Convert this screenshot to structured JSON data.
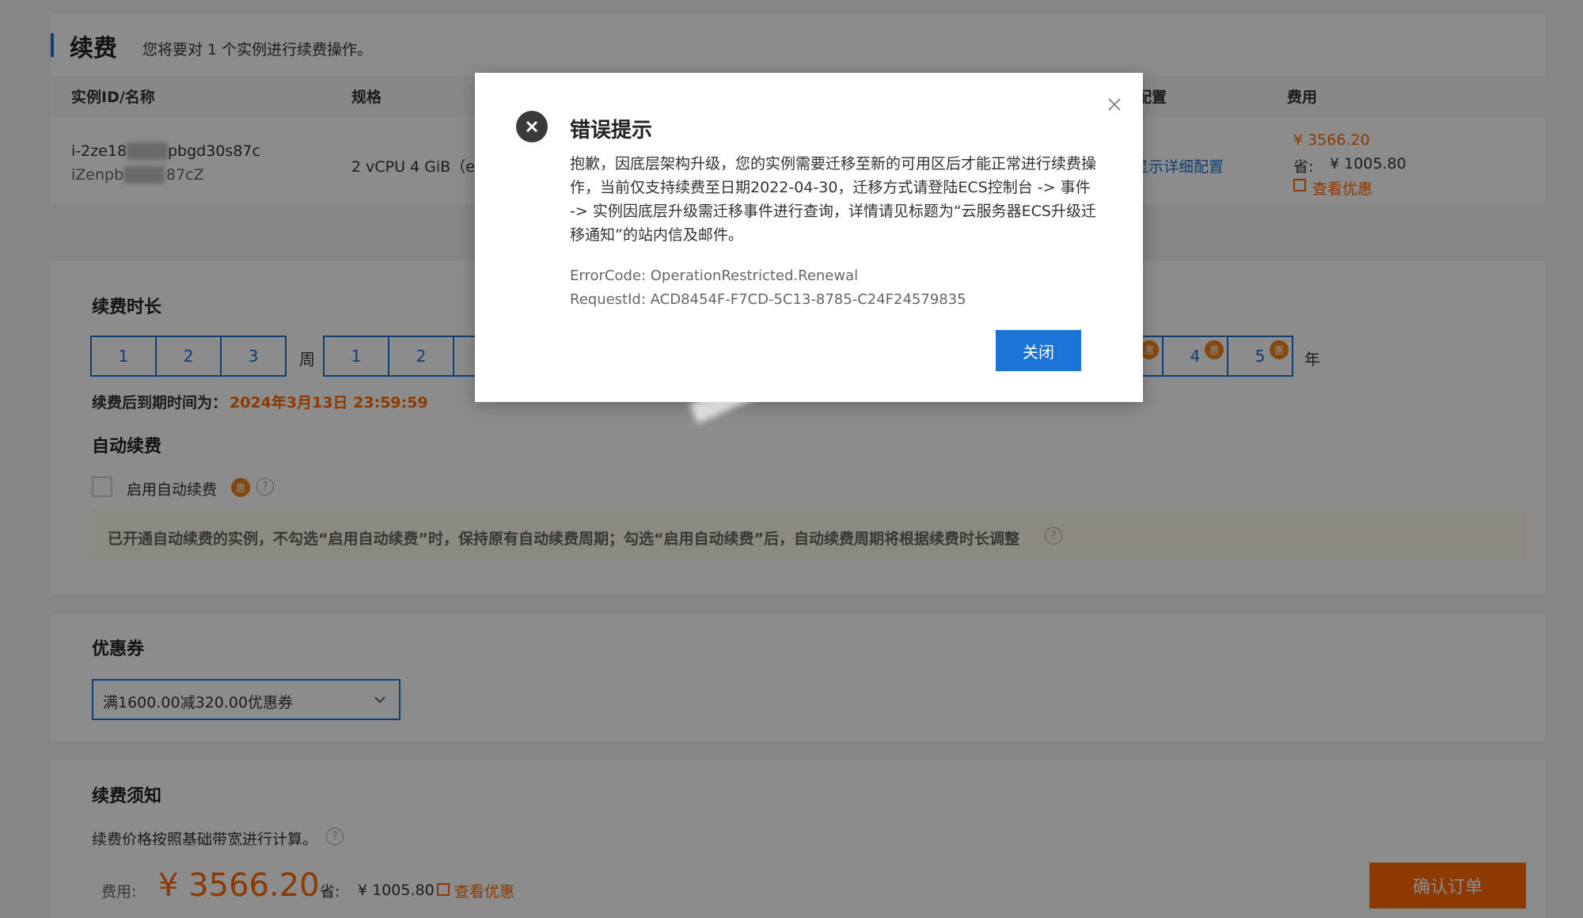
{
  "header": {
    "title": "续费",
    "subtitle": "您将要对 1 个实例进行续费操作。"
  },
  "instance_table": {
    "columns": [
      "实例ID/名称",
      "规格",
      "配置",
      "费用"
    ],
    "row": {
      "id_start": "i-2ze18",
      "id_end": "pbgd30s87c",
      "name_start": "iZenpb",
      "name_end": "87cZ",
      "spec": "2 vCPU 4 GiB（e",
      "config_link": "显示详细配置",
      "price": "¥ 3566.20",
      "save_label": "省:",
      "save_amount": "¥ 1005.80",
      "view_discount": "查看优惠"
    }
  },
  "duration": {
    "title": "续费时长",
    "week_options": [
      "1",
      "2",
      "3"
    ],
    "week_unit": "周",
    "month_options": [
      "1",
      "2"
    ],
    "year_options": [
      "4",
      "5"
    ],
    "year_unit": "年",
    "discount_badge": "惠",
    "expiry_label": "续费后到期时间为：",
    "expiry_value": "2024年3月13日 23:59:59"
  },
  "auto_renew": {
    "title": "自动续费",
    "checkbox_label": "启用自动续费",
    "checked": false,
    "badge": "惠",
    "notice": "已开通自动续费的实例，不勾选“启用自动续费”时，保持原有自动续费周期；勾选“启用自动续费”后，自动续费周期将根据续费时长调整"
  },
  "coupon": {
    "title": "优惠券",
    "selected": "满1600.00减320.00优惠券"
  },
  "terms": {
    "title": "续费须知",
    "text": "续费价格按照基础带宽进行计算。"
  },
  "footer": {
    "fee_label": "费用:",
    "fee_value": "¥ 3566.20",
    "save_label": "省:",
    "save_value": "¥ 1005.80",
    "view_discount": "查看优惠",
    "confirm_button": "确认订单"
  },
  "dialog": {
    "title": "错误提示",
    "body": "抱歉，因底层架构升级，您的实例需要迁移至新的可用区后才能正常进行续费操作，当前仅支持续费至日期2022-04-30，迁移方式请登陆ECS控制台 -> 事件 -> 实例因底层升级需迁移事件进行查询，详情请见标题为“云服务器ECS升级迁移通知”的站内信及邮件。",
    "error_code_label": "ErrorCode:",
    "error_code": "OperationRestricted.Renewal",
    "request_id_label": "RequestId:",
    "request_id": "ACD8454F-F7CD-5C13-8785-C24F24579835",
    "close_button": "关闭"
  },
  "colors": {
    "accent": "#1a74d6",
    "price": "#ff6a00",
    "overlay": "rgba(0,0,0,0.45)"
  }
}
